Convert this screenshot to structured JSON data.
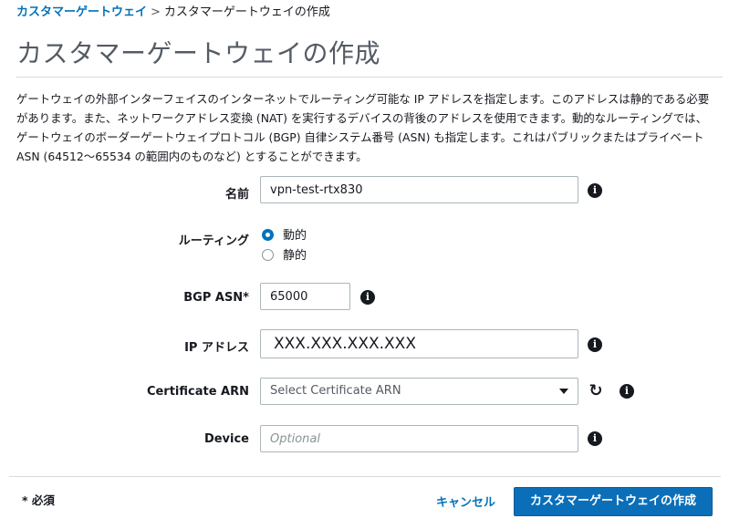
{
  "breadcrumb": {
    "parent": "カスタマーゲートウェイ",
    "separator": ">",
    "current": "カスタマーゲートウェイの作成"
  },
  "page_title": "カスタマーゲートウェイの作成",
  "description": "ゲートウェイの外部インターフェイスのインターネットでルーティング可能な IP アドレスを指定します。このアドレスは静的である必要があります。また、ネットワークアドレス変換 (NAT) を実行するデバイスの背後のアドレスを使用できます。動的なルーティングでは、ゲートウェイのボーダーゲートウェイプロトコル (BGP) 自律システム番号 (ASN) も指定します。これはパブリックまたはプライベート ASN (64512〜65534 の範囲内のものなど) とすることができます。",
  "form": {
    "name": {
      "label": "名前",
      "value": "vpn-test-rtx830"
    },
    "routing": {
      "label": "ルーティング",
      "options": [
        {
          "label": "動的",
          "selected": true
        },
        {
          "label": "静的",
          "selected": false
        }
      ]
    },
    "bgp_asn": {
      "label": "BGP ASN*",
      "value": "65000"
    },
    "ip_address": {
      "label": "IP アドレス",
      "value": "XXX.XXX.XXX.XXX"
    },
    "certificate_arn": {
      "label": "Certificate ARN",
      "placeholder": "Select Certificate ARN"
    },
    "device": {
      "label": "Device",
      "placeholder": "Optional"
    }
  },
  "icons": {
    "info": "info-icon",
    "refresh": "refresh-icon",
    "dropdown": "chevron-down-icon"
  },
  "footer": {
    "required_note": "* 必須",
    "cancel_label": "キャンセル",
    "create_label": "カスタマーゲートウェイの作成"
  },
  "colors": {
    "link": "#0073bb",
    "primary_button": "#0a6fb8",
    "title": "#545b64"
  }
}
